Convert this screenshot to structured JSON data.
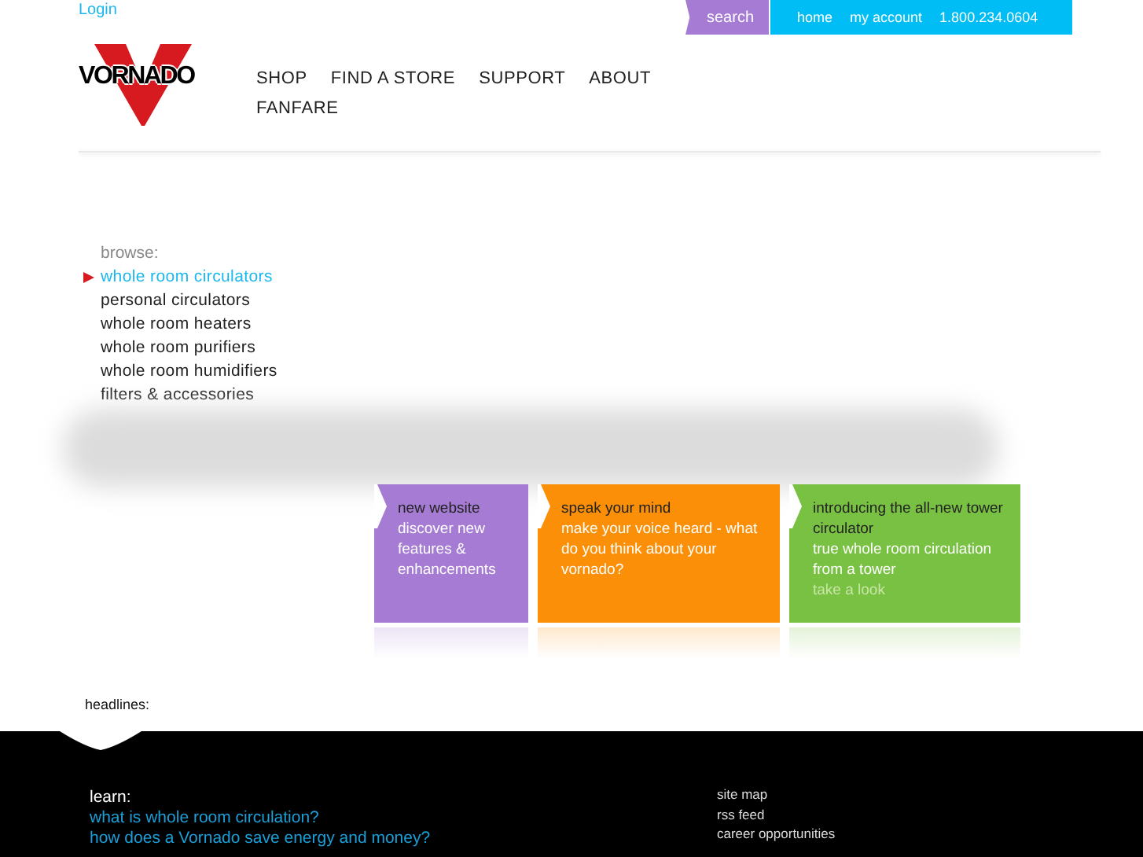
{
  "header": {
    "login": "Login",
    "search": "search",
    "top_links": [
      "home",
      "my account",
      "1.800.234.0604"
    ],
    "logo": "VORNADO"
  },
  "nav": [
    "SHOP",
    "FIND A STORE",
    "SUPPORT",
    "ABOUT",
    "FANFARE"
  ],
  "browse": {
    "label": "browse:",
    "items": [
      {
        "label": "whole room circulators",
        "selected": true
      },
      {
        "label": "personal circulators",
        "selected": false
      },
      {
        "label": "whole room heaters",
        "selected": false
      },
      {
        "label": "whole room purifiers",
        "selected": false
      },
      {
        "label": "whole room humidifiers",
        "selected": false
      },
      {
        "label": "filters & accessories",
        "selected": false
      }
    ]
  },
  "cards": [
    {
      "title": "new website",
      "body": "discover new features & enhancements",
      "color": "#a57bd3"
    },
    {
      "title": "speak your mind",
      "body": "make your voice heard - what do you think about your vornado?",
      "color": "#fb8f07"
    },
    {
      "title": "introducing the all-new tower circulator",
      "body": "true whole room circulation from a tower",
      "link": "take a look",
      "color": "#79c142"
    }
  ],
  "headlines": "headlines:",
  "footer": {
    "learn": {
      "label": "learn:",
      "links": [
        "what is whole room circulation?",
        "how does a Vornado save energy and money?"
      ]
    },
    "links": [
      "site map",
      "rss feed",
      "career opportunities"
    ]
  }
}
